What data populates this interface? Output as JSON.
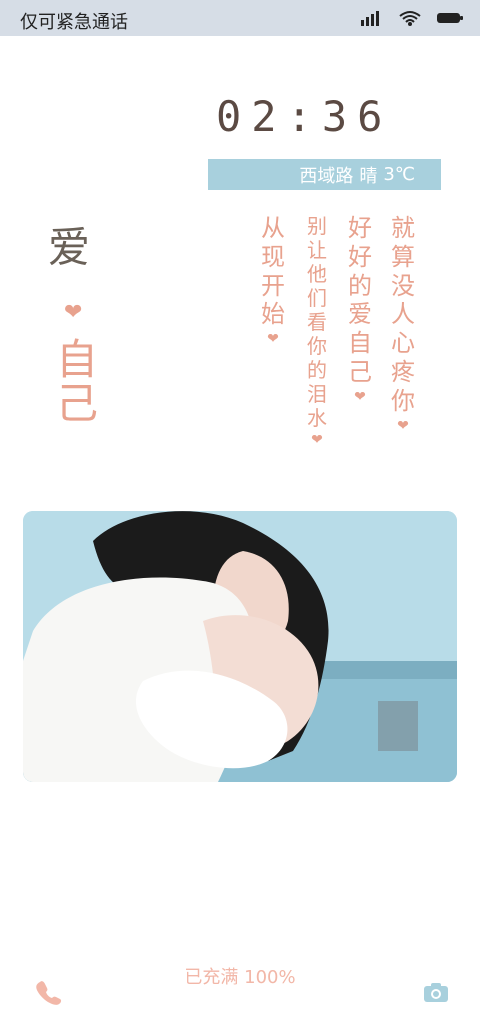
{
  "status_bar": {
    "left_text": "仅可紧急通话",
    "icons": [
      "signal-icon",
      "wifi-icon",
      "battery-icon"
    ]
  },
  "lockscreen": {
    "time": "02:36",
    "weather": {
      "location": "西域路",
      "condition": "晴",
      "temp": "3℃"
    },
    "left_vertical": {
      "word1": "爱",
      "word2": "自己",
      "heart": "❤"
    },
    "poem": {
      "col1": [
        "从",
        "现",
        "开",
        "始"
      ],
      "col2": [
        "别",
        "让",
        "他",
        "们",
        "看",
        "你",
        "的",
        "泪",
        "水"
      ],
      "col3": [
        "好",
        "好",
        "的",
        "爱",
        "自",
        "己"
      ],
      "col4": [
        "就",
        "算",
        "没",
        "人",
        "心",
        "疼",
        "你"
      ],
      "heart": "❤"
    },
    "charge_text": "已充满 100%"
  },
  "colors": {
    "status_bar_bg": "#d6dde6",
    "weather_bg": "#a8d0dd",
    "accent_pink": "#e8a28e",
    "text_brown": "#5b4a43"
  }
}
